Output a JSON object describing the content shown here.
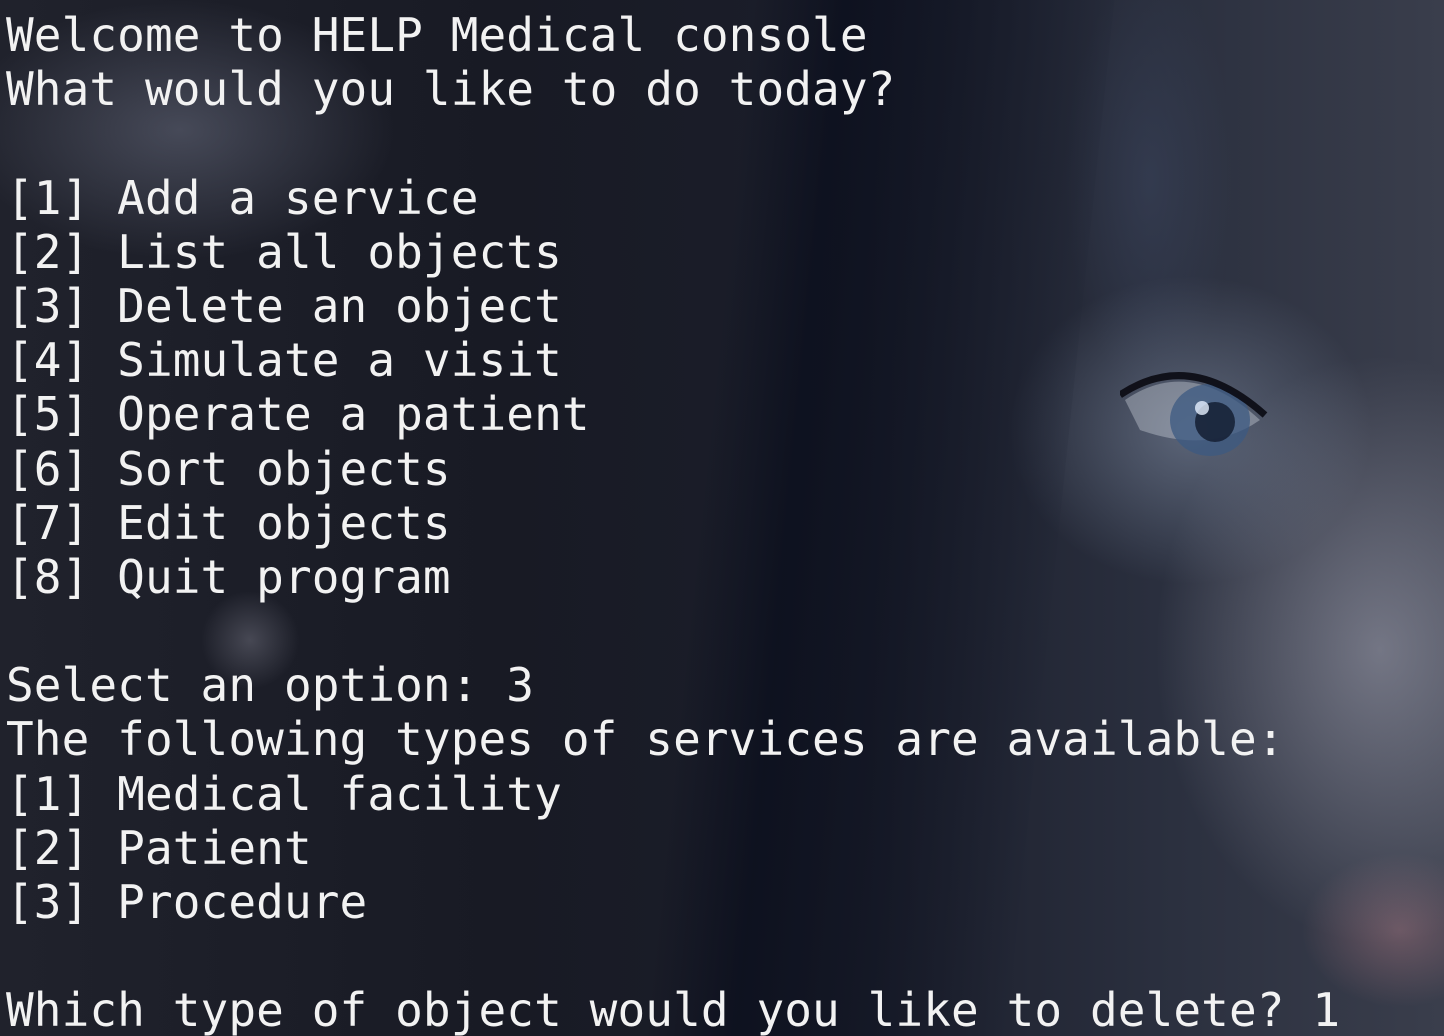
{
  "terminal": {
    "lines": [
      "Welcome to HELP Medical console",
      "What would you like to do today?",
      "",
      "[1] Add a service",
      "[2] List all objects",
      "[3] Delete an object",
      "[4] Simulate a visit",
      "[5] Operate a patient",
      "[6] Sort objects",
      "[7] Edit objects",
      "[8] Quit program",
      "",
      "Select an option: 3",
      "The following types of services are available:",
      "[1] Medical facility",
      "[2] Patient",
      "[3] Procedure",
      "",
      "Which type of object would you like to delete? 1"
    ]
  }
}
